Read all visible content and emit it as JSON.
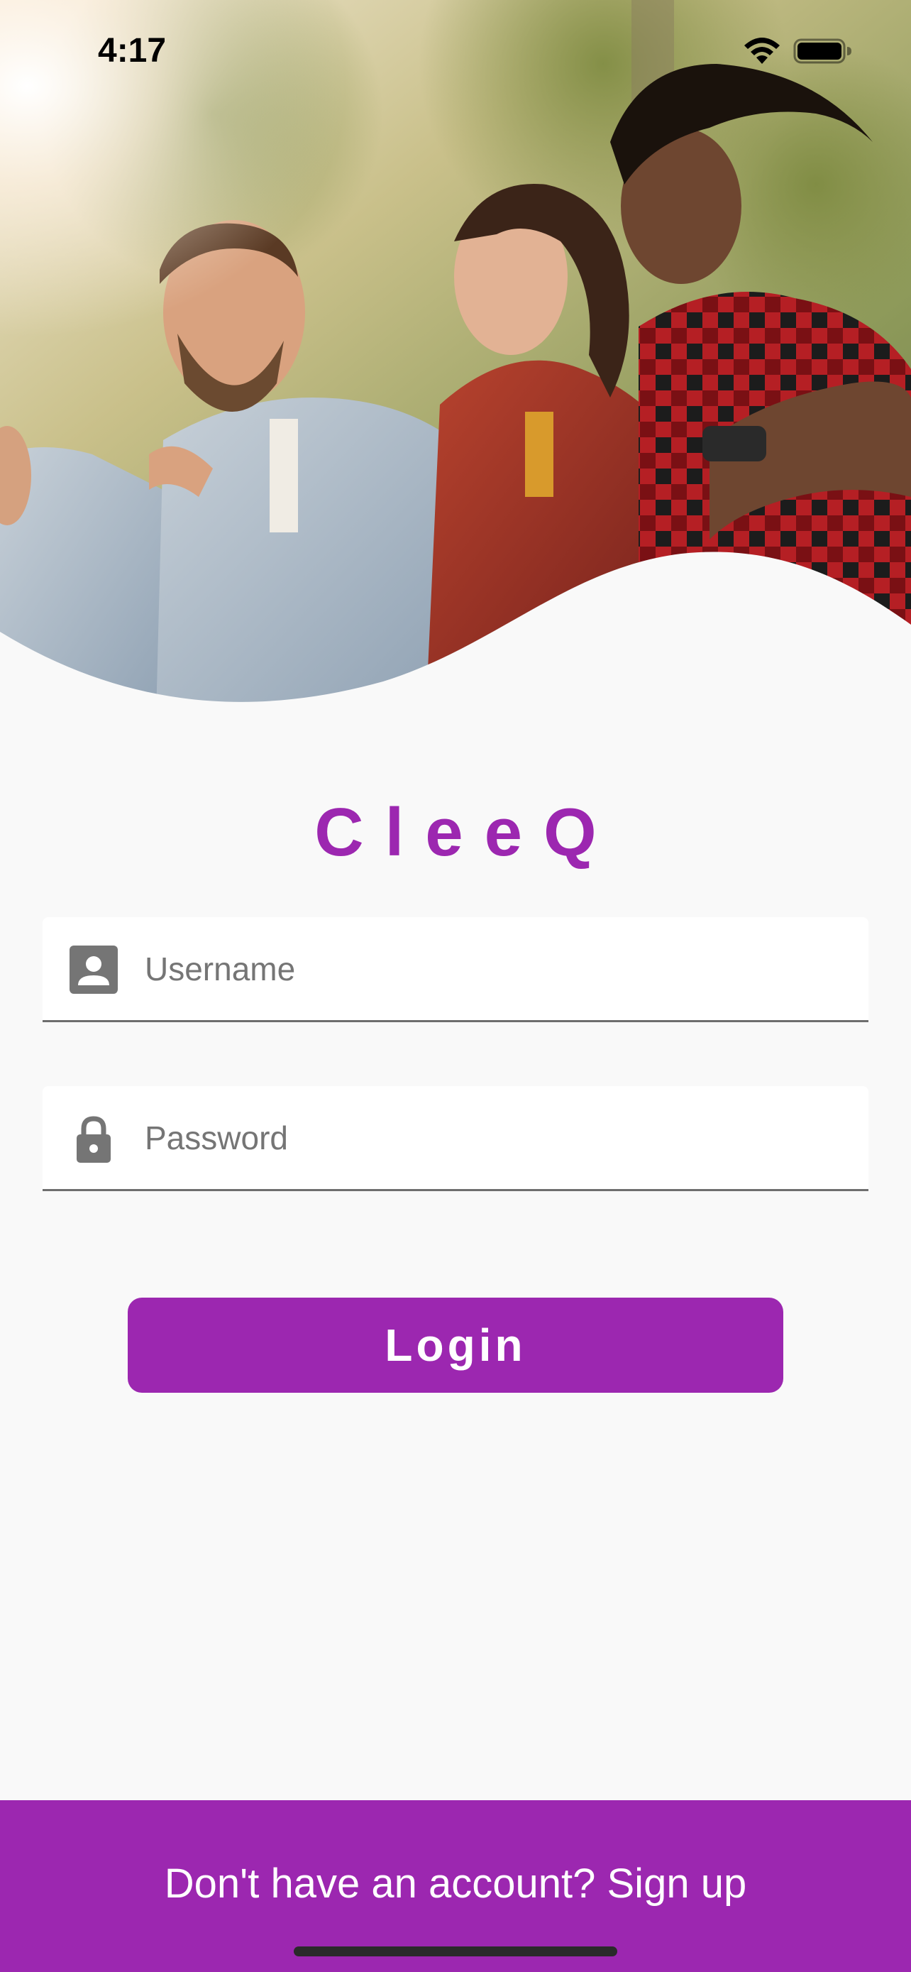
{
  "status_bar": {
    "time": "4:17",
    "wifi_icon": "wifi-icon",
    "battery_icon": "battery-full-icon"
  },
  "hero": {
    "image_description": "group-of-young-friends-photo"
  },
  "brand": {
    "title": "CleeQ",
    "color": "#9c27b0"
  },
  "form": {
    "username": {
      "placeholder": "Username",
      "value": "",
      "icon": "account-box-icon"
    },
    "password": {
      "placeholder": "Password",
      "value": "",
      "icon": "lock-icon"
    },
    "login_label": "Login"
  },
  "footer": {
    "signup_text": "Don't have an account? Sign up",
    "background": "#9c27b0"
  }
}
